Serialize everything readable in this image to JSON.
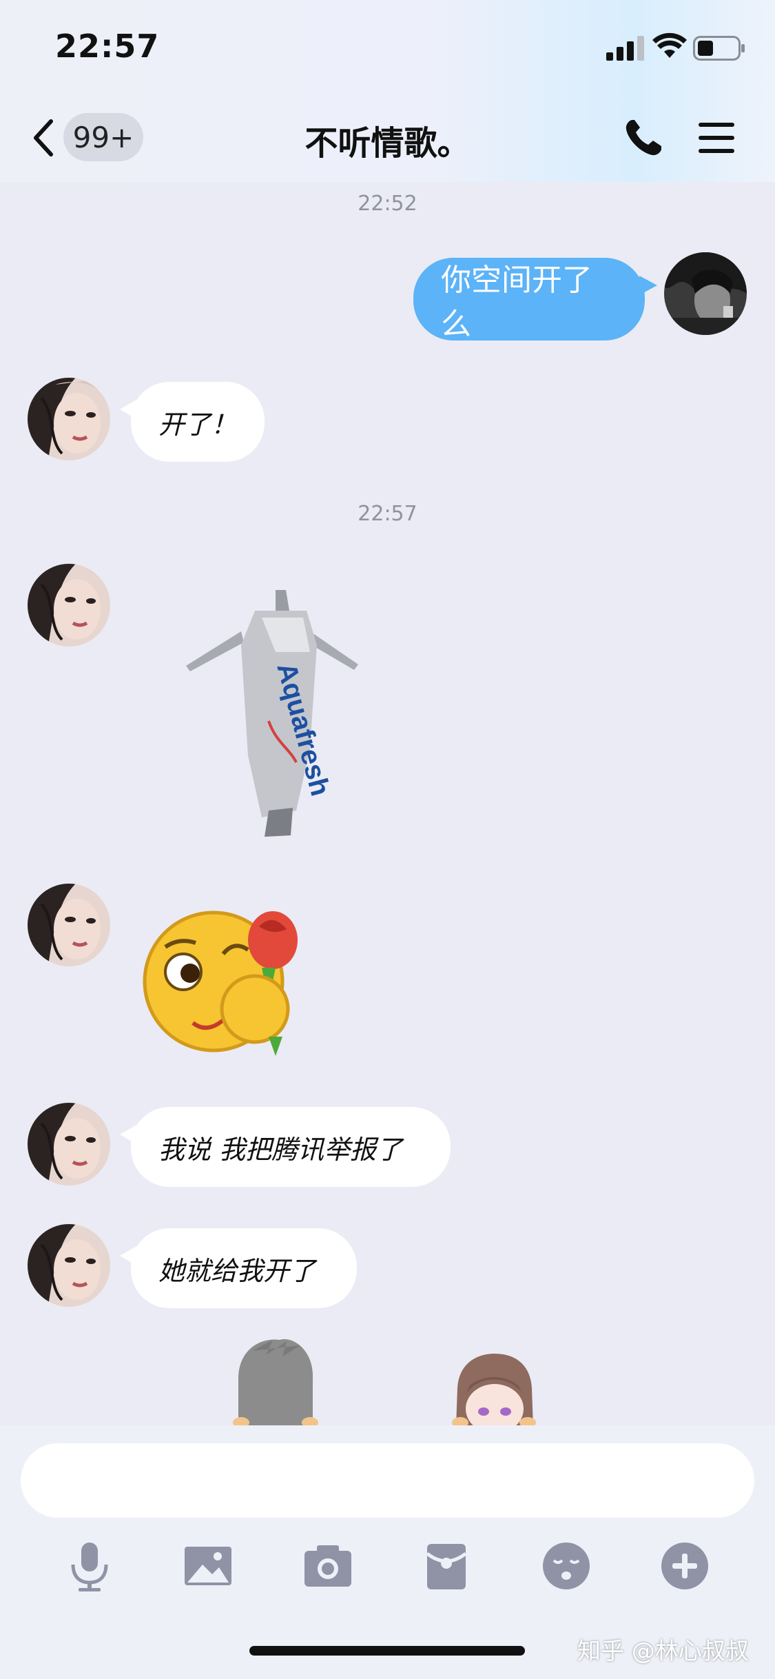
{
  "status_bar": {
    "time": "22:57"
  },
  "nav": {
    "back_badge": "99+",
    "title": "不听情歌。"
  },
  "messages": {
    "timestamp_1": "22:52",
    "out_1": "你空间开了么",
    "in_1": "开了！",
    "timestamp_2": "22:57",
    "in_2": "我说 我把腾讯举报了",
    "in_3": "她就给我开了"
  },
  "stickers": {
    "toothpaste_label": "Aquafresh"
  },
  "input": {
    "placeholder": ""
  },
  "watermark": "知乎 @林心叔叔",
  "colors": {
    "outgoing_bubble": "#5cb3f7",
    "background": "#eaebf4",
    "icon_gray": "#9093a6"
  }
}
